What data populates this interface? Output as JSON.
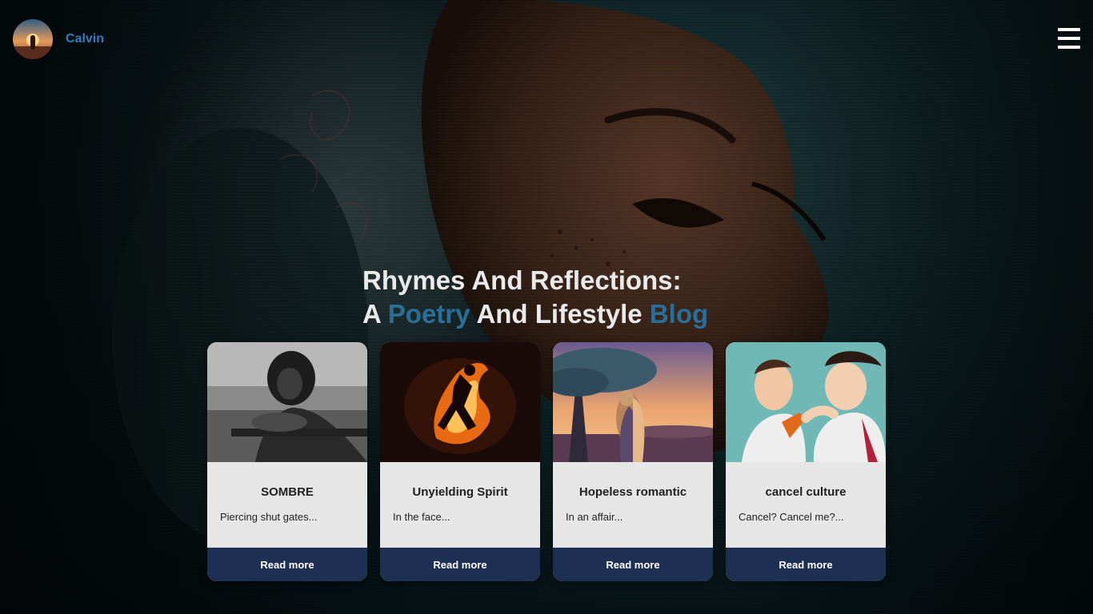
{
  "header": {
    "user_name": "Calvin",
    "avatar_icon": "sunset-avatar",
    "menu_icon": "hamburger-menu-icon"
  },
  "hero": {
    "title_line1": "Rhymes And Reflections:",
    "title_line2_a": "A ",
    "title_line2_accent1": "Poetry",
    "title_line2_b": " And Lifestyle ",
    "title_line2_accent2": "Blog",
    "accent_color": "#2a6f9a"
  },
  "cards": [
    {
      "title": "SOMBRE",
      "excerpt": "Piercing shut gates...",
      "button": "Read more",
      "image": "grayscale-woman-leaning-on-railing"
    },
    {
      "title": "Unyielding Spirit",
      "excerpt": "In the face...",
      "button": "Read more",
      "image": "fiery-running-figure"
    },
    {
      "title": "Hopeless romantic",
      "excerpt": "In an affair...",
      "button": "Read more",
      "image": "couple-embracing-under-tree-at-sunset"
    },
    {
      "title": "cancel culture",
      "excerpt": "Cancel? Cancel me?...",
      "button": "Read more",
      "image": "cartoon-man-grabbing-another-by-tie"
    }
  ],
  "colors": {
    "brand_name": "#2f7cc2",
    "button_bg": "#1d2f52",
    "card_bg": "#e6e6e6"
  }
}
